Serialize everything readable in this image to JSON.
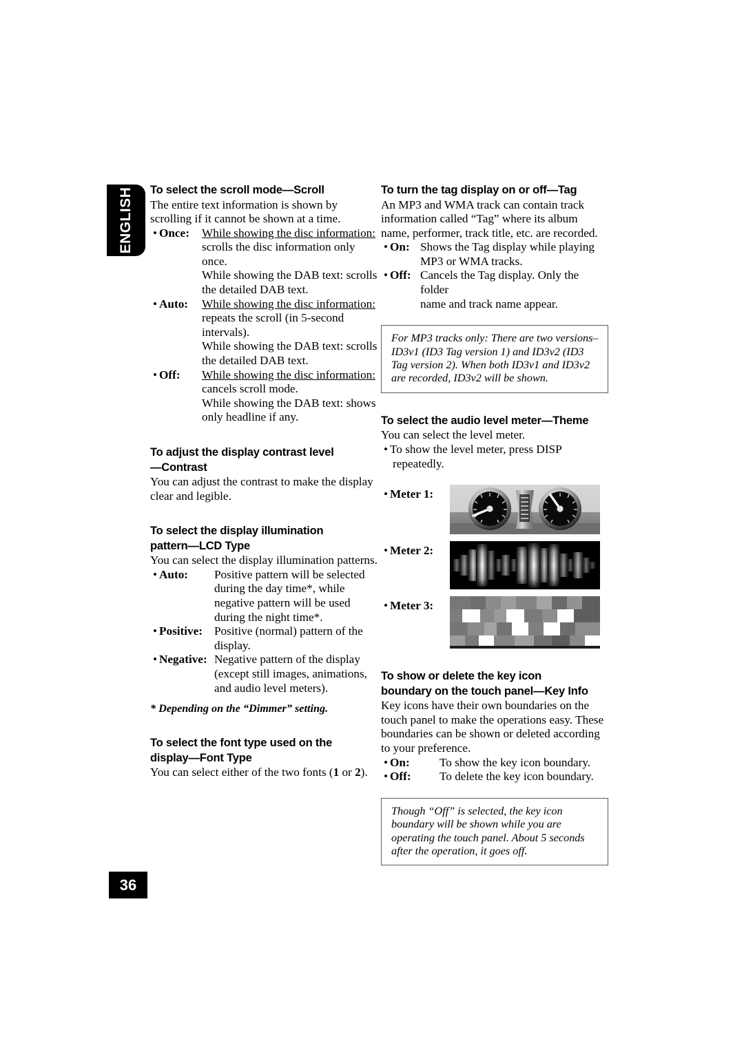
{
  "language_tab": "ENGLISH",
  "page_number": "36",
  "left_column": {
    "scroll": {
      "heading": "To select the scroll mode—Scroll",
      "intro": "The entire text information is shown by scrolling if it cannot be shown at a time.",
      "options": [
        {
          "bullet": "•",
          "term": "Once",
          "colon": ":",
          "lines": [
            {
              "underline": "While showing the disc information:",
              "rest": ""
            },
            {
              "underline": "",
              "rest": "scrolls the disc information only"
            },
            {
              "underline": "",
              "rest": "once."
            },
            {
              "underline": "While showing the DAB text:",
              "rest": " scrolls"
            },
            {
              "underline": "",
              "rest": "the detailed DAB text."
            }
          ]
        },
        {
          "bullet": "•",
          "term": "Auto",
          "colon": ":",
          "lines": [
            {
              "underline": "While showing the disc information:",
              "rest": ""
            },
            {
              "underline": "",
              "rest": "repeats the scroll (in 5-second"
            },
            {
              "underline": "",
              "rest": "intervals)."
            },
            {
              "underline": "While showing the DAB text:",
              "rest": " scrolls"
            },
            {
              "underline": "",
              "rest": "the detailed DAB text."
            }
          ]
        },
        {
          "bullet": "•",
          "term": "Off",
          "colon": ":",
          "lines": [
            {
              "underline": "While showing the disc information:",
              "rest": ""
            },
            {
              "underline": "",
              "rest": "cancels scroll mode."
            },
            {
              "underline": "While showing the DAB text:",
              "rest": " shows"
            },
            {
              "underline": "",
              "rest": "only headline if any."
            }
          ]
        }
      ]
    },
    "contrast": {
      "heading_line1": "To adjust the display contrast level",
      "heading_line2": "—Contrast",
      "body": "You can adjust the contrast to make the display clear and legible."
    },
    "lcd_type": {
      "heading_line1": "To select the display illumination",
      "heading_line2": "pattern—LCD Type",
      "body": "You can select the display illumination patterns.",
      "options": [
        {
          "bullet": "•",
          "term": "Auto",
          "colon": ":",
          "lines": [
            "Positive pattern will be selected",
            "during the day time*, while",
            "negative pattern will be used",
            "during the night time*."
          ]
        },
        {
          "bullet": "•",
          "term": "Positive",
          "colon": ":",
          "lines": [
            "Positive (normal) pattern of the",
            "display."
          ]
        },
        {
          "bullet": "•",
          "term": "Negative",
          "colon": ":",
          "lines": [
            "Negative pattern of the display",
            "(except still images, animations,",
            "and audio level meters)."
          ]
        }
      ],
      "footnote": "*  Depending on the “Dimmer” setting."
    },
    "font_type": {
      "heading_line1": "To select the font type used on the",
      "heading_line2": "display—Font Type",
      "body_pre": "You can select either of the two fonts (",
      "body_bold1": "1",
      "body_mid": " or ",
      "body_bold2": "2",
      "body_post": ")."
    }
  },
  "right_column": {
    "tag": {
      "heading": "To turn the tag display on or off—Tag",
      "body": "An MP3 and WMA track can contain track information called “Tag” where its album name, performer, track title, etc. are recorded.",
      "options": [
        {
          "bullet": "•",
          "term": "On",
          "colon": ":",
          "lines": [
            "Shows the Tag display while playing",
            "MP3 or WMA tracks."
          ]
        },
        {
          "bullet": "•",
          "term": "Off",
          "colon": ":",
          "lines": [
            "Cancels the Tag display. Only the folder",
            "name and track name appear."
          ]
        }
      ],
      "note": "For MP3 tracks only: There are two versions– ID3v1 (ID3 Tag version 1) and ID3v2 (ID3 Tag version 2). When both ID3v1 and ID3v2 are recorded, ID3v2 will be shown."
    },
    "theme": {
      "heading": "To select the audio level meter—Theme",
      "body": "You can select the level meter.",
      "bullet_item": {
        "bullet": "•",
        "lines": [
          "To show the level meter, press DISP",
          "repeatedly."
        ]
      },
      "meters": [
        {
          "bullet": "•",
          "label": "Meter 1",
          "colon": ":",
          "image": "analog-gauges-image"
        },
        {
          "bullet": "•",
          "label": "Meter 2",
          "colon": ":",
          "image": "waveform-spectrum-image"
        },
        {
          "bullet": "•",
          "label": "Meter 3",
          "colon": ":",
          "image": "block-grid-image"
        }
      ]
    },
    "key_info": {
      "heading_line1": "To show or delete the key icon",
      "heading_line2": "boundary on the touch panel—Key Info",
      "body": "Key icons have their own boundaries on the touch panel to make the operations easy. These boundaries can be shown or deleted according to your preference.",
      "options": [
        {
          "bullet": "•",
          "term": "On",
          "colon": ":",
          "text": "To show the key icon boundary."
        },
        {
          "bullet": "•",
          "term": "Off",
          "colon": ":",
          "text": "To delete the key icon boundary."
        }
      ],
      "note": "Though “Off” is selected, the key icon boundary will be shown while you are operating the touch panel. About 5 seconds after the operation, it goes off."
    }
  },
  "colors": {
    "ink": "#000000",
    "paper": "#ffffff",
    "box_border": "#5a5a5a"
  }
}
